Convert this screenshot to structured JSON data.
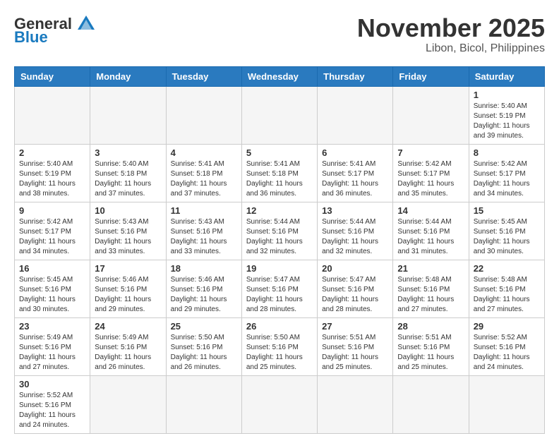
{
  "logo": {
    "general": "General",
    "blue": "Blue"
  },
  "header": {
    "month": "November 2025",
    "location": "Libon, Bicol, Philippines"
  },
  "weekdays": [
    "Sunday",
    "Monday",
    "Tuesday",
    "Wednesday",
    "Thursday",
    "Friday",
    "Saturday"
  ],
  "weeks": [
    [
      {
        "day": null
      },
      {
        "day": null
      },
      {
        "day": null
      },
      {
        "day": null
      },
      {
        "day": null
      },
      {
        "day": null
      },
      {
        "day": 1,
        "sunrise": "Sunrise: 5:40 AM",
        "sunset": "Sunset: 5:19 PM",
        "daylight": "Daylight: 11 hours and 39 minutes."
      }
    ],
    [
      {
        "day": 2,
        "sunrise": "Sunrise: 5:40 AM",
        "sunset": "Sunset: 5:19 PM",
        "daylight": "Daylight: 11 hours and 38 minutes."
      },
      {
        "day": 3,
        "sunrise": "Sunrise: 5:40 AM",
        "sunset": "Sunset: 5:18 PM",
        "daylight": "Daylight: 11 hours and 37 minutes."
      },
      {
        "day": 4,
        "sunrise": "Sunrise: 5:41 AM",
        "sunset": "Sunset: 5:18 PM",
        "daylight": "Daylight: 11 hours and 37 minutes."
      },
      {
        "day": 5,
        "sunrise": "Sunrise: 5:41 AM",
        "sunset": "Sunset: 5:18 PM",
        "daylight": "Daylight: 11 hours and 36 minutes."
      },
      {
        "day": 6,
        "sunrise": "Sunrise: 5:41 AM",
        "sunset": "Sunset: 5:17 PM",
        "daylight": "Daylight: 11 hours and 36 minutes."
      },
      {
        "day": 7,
        "sunrise": "Sunrise: 5:42 AM",
        "sunset": "Sunset: 5:17 PM",
        "daylight": "Daylight: 11 hours and 35 minutes."
      },
      {
        "day": 8,
        "sunrise": "Sunrise: 5:42 AM",
        "sunset": "Sunset: 5:17 PM",
        "daylight": "Daylight: 11 hours and 34 minutes."
      }
    ],
    [
      {
        "day": 9,
        "sunrise": "Sunrise: 5:42 AM",
        "sunset": "Sunset: 5:17 PM",
        "daylight": "Daylight: 11 hours and 34 minutes."
      },
      {
        "day": 10,
        "sunrise": "Sunrise: 5:43 AM",
        "sunset": "Sunset: 5:16 PM",
        "daylight": "Daylight: 11 hours and 33 minutes."
      },
      {
        "day": 11,
        "sunrise": "Sunrise: 5:43 AM",
        "sunset": "Sunset: 5:16 PM",
        "daylight": "Daylight: 11 hours and 33 minutes."
      },
      {
        "day": 12,
        "sunrise": "Sunrise: 5:44 AM",
        "sunset": "Sunset: 5:16 PM",
        "daylight": "Daylight: 11 hours and 32 minutes."
      },
      {
        "day": 13,
        "sunrise": "Sunrise: 5:44 AM",
        "sunset": "Sunset: 5:16 PM",
        "daylight": "Daylight: 11 hours and 32 minutes."
      },
      {
        "day": 14,
        "sunrise": "Sunrise: 5:44 AM",
        "sunset": "Sunset: 5:16 PM",
        "daylight": "Daylight: 11 hours and 31 minutes."
      },
      {
        "day": 15,
        "sunrise": "Sunrise: 5:45 AM",
        "sunset": "Sunset: 5:16 PM",
        "daylight": "Daylight: 11 hours and 30 minutes."
      }
    ],
    [
      {
        "day": 16,
        "sunrise": "Sunrise: 5:45 AM",
        "sunset": "Sunset: 5:16 PM",
        "daylight": "Daylight: 11 hours and 30 minutes."
      },
      {
        "day": 17,
        "sunrise": "Sunrise: 5:46 AM",
        "sunset": "Sunset: 5:16 PM",
        "daylight": "Daylight: 11 hours and 29 minutes."
      },
      {
        "day": 18,
        "sunrise": "Sunrise: 5:46 AM",
        "sunset": "Sunset: 5:16 PM",
        "daylight": "Daylight: 11 hours and 29 minutes."
      },
      {
        "day": 19,
        "sunrise": "Sunrise: 5:47 AM",
        "sunset": "Sunset: 5:16 PM",
        "daylight": "Daylight: 11 hours and 28 minutes."
      },
      {
        "day": 20,
        "sunrise": "Sunrise: 5:47 AM",
        "sunset": "Sunset: 5:16 PM",
        "daylight": "Daylight: 11 hours and 28 minutes."
      },
      {
        "day": 21,
        "sunrise": "Sunrise: 5:48 AM",
        "sunset": "Sunset: 5:16 PM",
        "daylight": "Daylight: 11 hours and 27 minutes."
      },
      {
        "day": 22,
        "sunrise": "Sunrise: 5:48 AM",
        "sunset": "Sunset: 5:16 PM",
        "daylight": "Daylight: 11 hours and 27 minutes."
      }
    ],
    [
      {
        "day": 23,
        "sunrise": "Sunrise: 5:49 AM",
        "sunset": "Sunset: 5:16 PM",
        "daylight": "Daylight: 11 hours and 27 minutes."
      },
      {
        "day": 24,
        "sunrise": "Sunrise: 5:49 AM",
        "sunset": "Sunset: 5:16 PM",
        "daylight": "Daylight: 11 hours and 26 minutes."
      },
      {
        "day": 25,
        "sunrise": "Sunrise: 5:50 AM",
        "sunset": "Sunset: 5:16 PM",
        "daylight": "Daylight: 11 hours and 26 minutes."
      },
      {
        "day": 26,
        "sunrise": "Sunrise: 5:50 AM",
        "sunset": "Sunset: 5:16 PM",
        "daylight": "Daylight: 11 hours and 25 minutes."
      },
      {
        "day": 27,
        "sunrise": "Sunrise: 5:51 AM",
        "sunset": "Sunset: 5:16 PM",
        "daylight": "Daylight: 11 hours and 25 minutes."
      },
      {
        "day": 28,
        "sunrise": "Sunrise: 5:51 AM",
        "sunset": "Sunset: 5:16 PM",
        "daylight": "Daylight: 11 hours and 25 minutes."
      },
      {
        "day": 29,
        "sunrise": "Sunrise: 5:52 AM",
        "sunset": "Sunset: 5:16 PM",
        "daylight": "Daylight: 11 hours and 24 minutes."
      }
    ],
    [
      {
        "day": 30,
        "sunrise": "Sunrise: 5:52 AM",
        "sunset": "Sunset: 5:16 PM",
        "daylight": "Daylight: 11 hours and 24 minutes."
      },
      {
        "day": null
      },
      {
        "day": null
      },
      {
        "day": null
      },
      {
        "day": null
      },
      {
        "day": null
      },
      {
        "day": null
      }
    ]
  ]
}
